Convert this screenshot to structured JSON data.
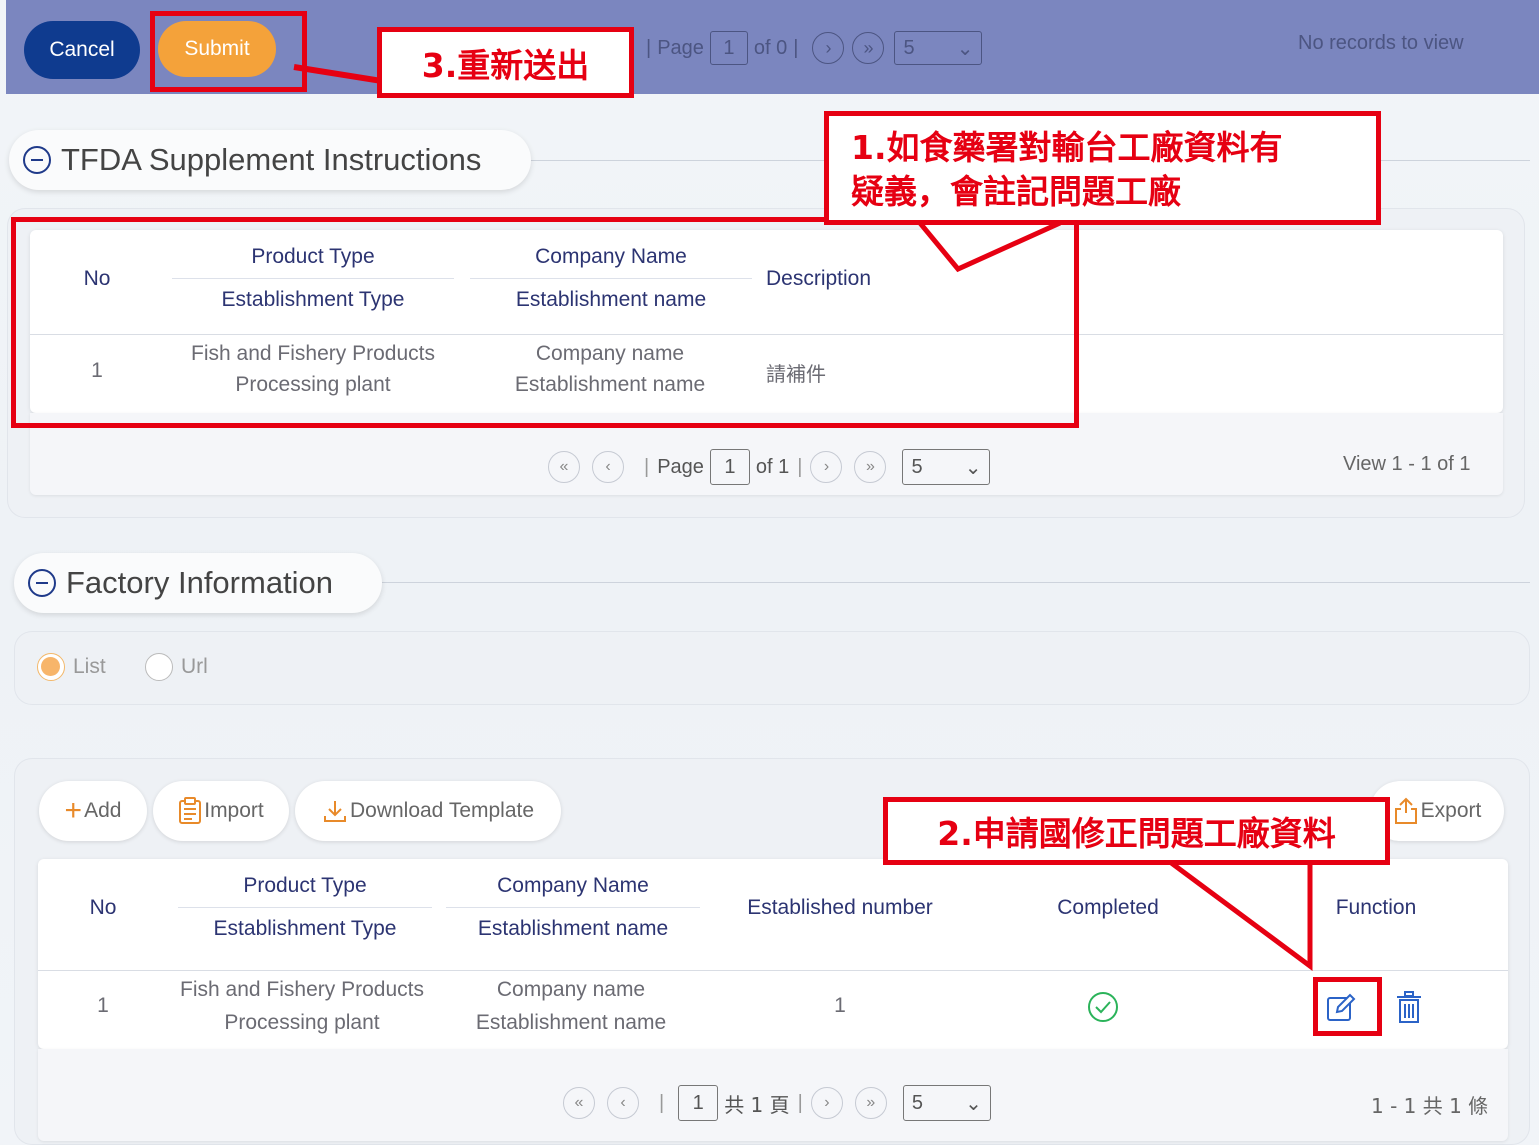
{
  "toolbar": {
    "cancel_label": "Cancel",
    "submit_label": "Submit",
    "pager": {
      "page_label": "Page",
      "page_value": "1",
      "of_label": "of 0",
      "page_size": "5"
    },
    "records_text": "No records to view"
  },
  "annotations": {
    "step1": [
      "1.如食藥署對輸台工廠資料有",
      "疑義，會註記問題工廠"
    ],
    "step2": "2.申請國修正問題工廠資料",
    "step3": "3.重新送出"
  },
  "supplement": {
    "title": "TFDA Supplement Instructions",
    "headers": {
      "no": "No",
      "product_type": "Product Type",
      "establishment_type": "Establishment Type",
      "company_name": "Company Name",
      "establishment_name": "Establishment name",
      "description": "Description"
    },
    "rows": [
      {
        "no": "1",
        "product_type": "Fish and Fishery Products",
        "establishment_type": "Processing plant",
        "company_name": "Company name",
        "establishment_name": "Establishment name",
        "description": "請補件"
      }
    ],
    "pager": {
      "page_label": "Page",
      "page_value": "1",
      "of_label": "of 1",
      "page_size": "5"
    },
    "view_text": "View 1 - 1 of 1"
  },
  "factory": {
    "title": "Factory Information",
    "radio": {
      "list_label": "List",
      "url_label": "Url",
      "selected": "List"
    },
    "buttons": {
      "add_label": "Add",
      "import_label": "Import",
      "download_label": "Download Template",
      "export_label": "Export"
    },
    "headers": {
      "no": "No",
      "product_type": "Product Type",
      "establishment_type": "Establishment Type",
      "company_name": "Company Name",
      "establishment_name": "Establishment name",
      "established_number": "Established number",
      "completed": "Completed",
      "function": "Function"
    },
    "rows": [
      {
        "no": "1",
        "product_type": "Fish and Fishery Products",
        "establishment_type": "Processing plant",
        "company_name": "Company name",
        "establishment_name": "Establishment name",
        "established_number": "1"
      }
    ],
    "pager": {
      "page_value": "1",
      "total_pages_label": "共 1 頁",
      "page_size": "5"
    },
    "view_text": "1 - 1 共 1 條"
  },
  "icons": {
    "first": "«",
    "prev": "‹",
    "next": "›",
    "last": "»",
    "dropdown": "⌄",
    "add": "+",
    "edit": "edit-icon",
    "delete": "trash-icon",
    "completed": "check-circle-icon"
  },
  "colors": {
    "accent": "#f4a23a",
    "primary": "#0f3b8f",
    "topbar": "#7b86bf",
    "highlight": "#e60012",
    "header_text": "#2c3472"
  }
}
